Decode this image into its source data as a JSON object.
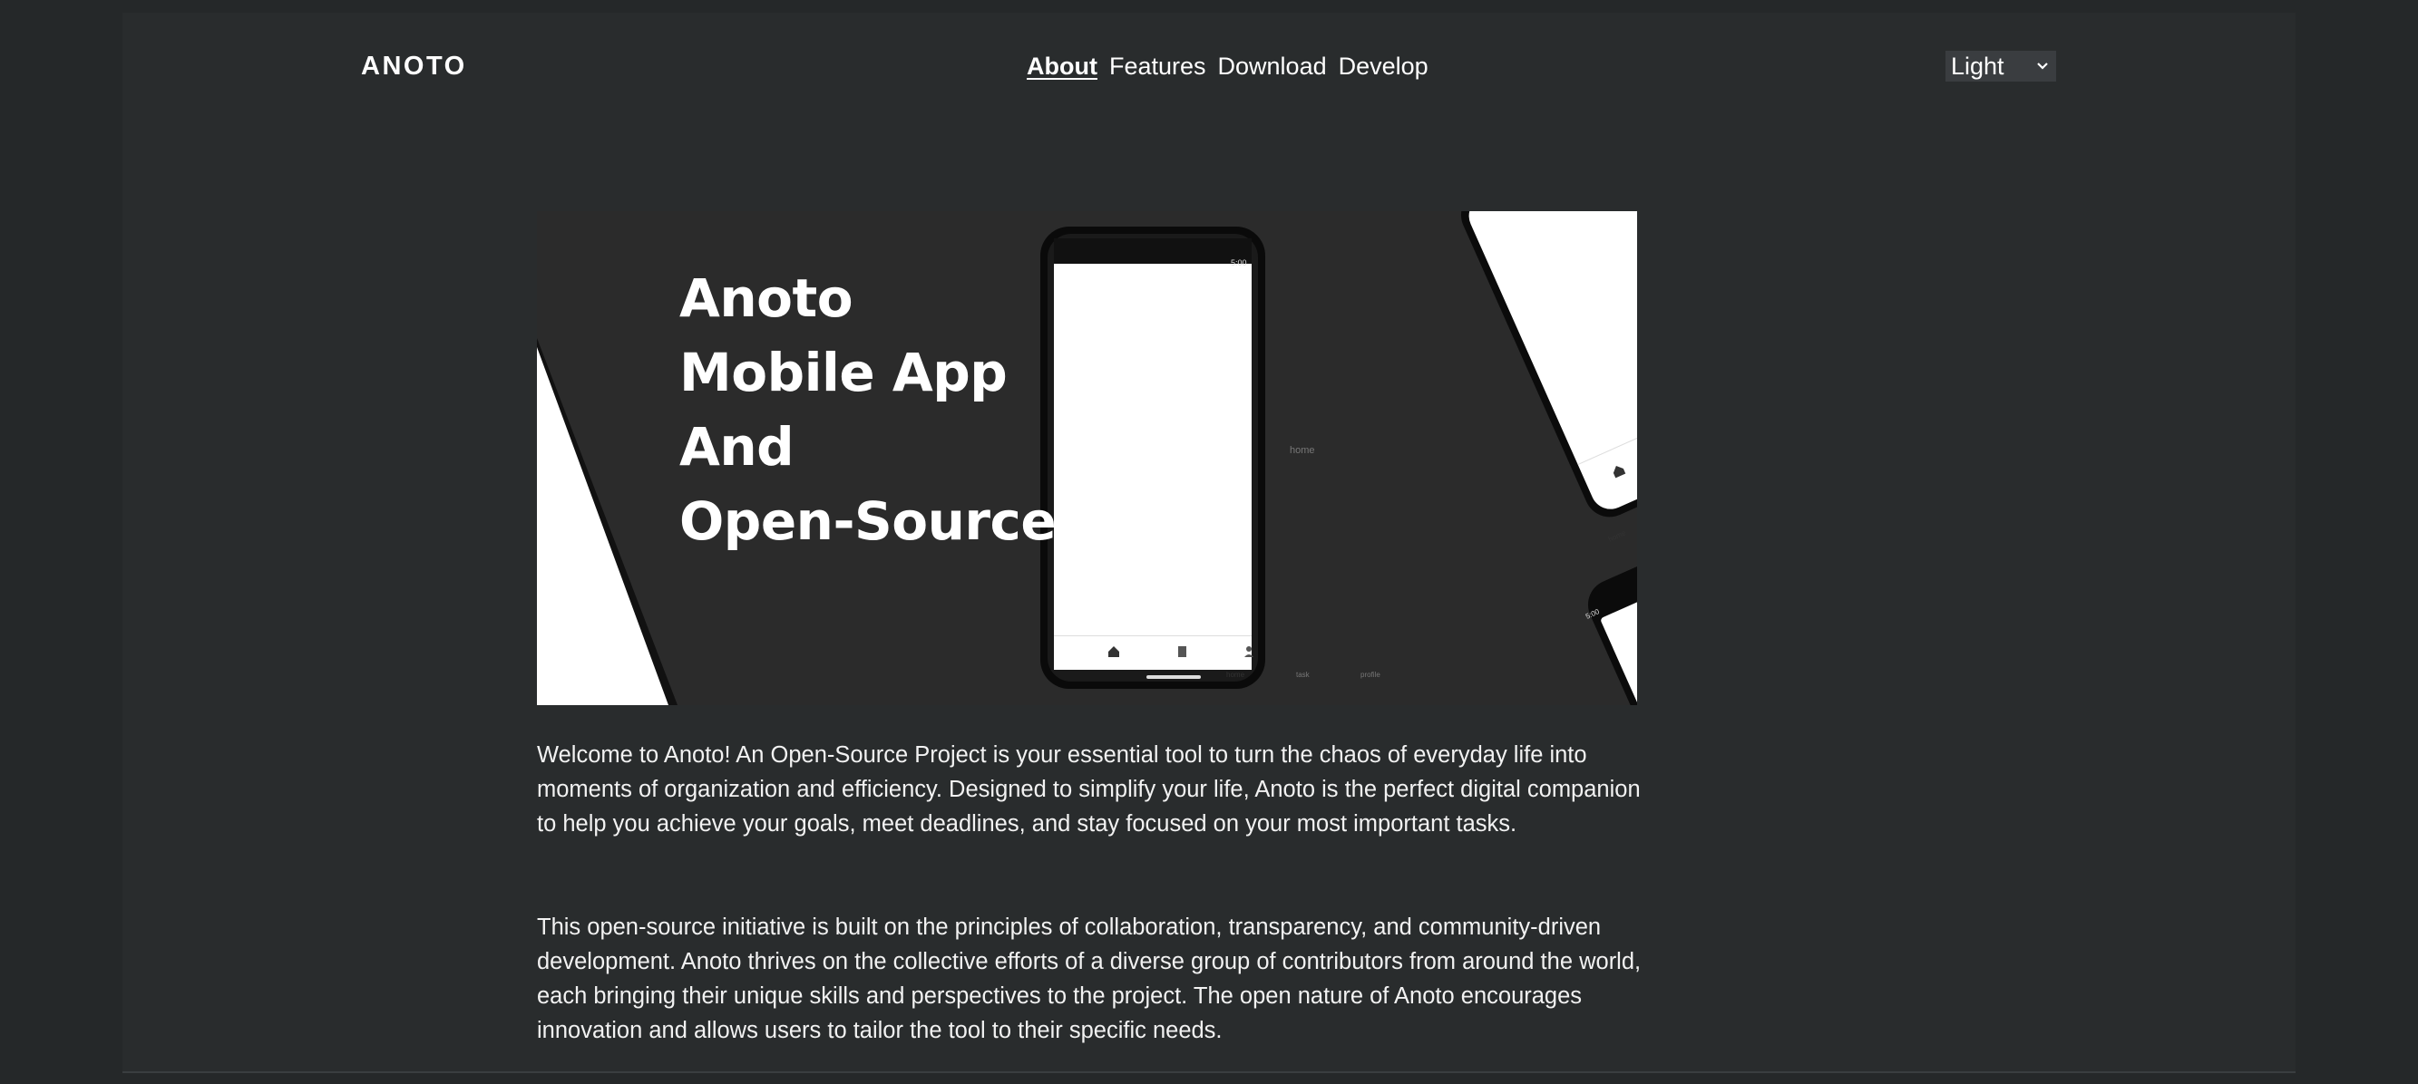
{
  "header": {
    "logo": "ANOTO",
    "nav": [
      {
        "label": "About",
        "active": true
      },
      {
        "label": "Features",
        "active": false
      },
      {
        "label": "Download",
        "active": false
      },
      {
        "label": "Develop",
        "active": false
      }
    ],
    "theme_select": {
      "value": "Light"
    }
  },
  "hero": {
    "title_lines": [
      "Anoto",
      "Mobile App",
      "And",
      "Open-Source"
    ],
    "phone_center": {
      "status_time": "5:00",
      "screen_label": "home",
      "tabs": [
        "home",
        "task",
        "profile"
      ]
    },
    "phone_right_top": {
      "screen_label": "home",
      "tabs": [
        "home",
        "task"
      ]
    },
    "phone_right_bottom": {
      "status_time": "5:00"
    }
  },
  "content": {
    "paragraphs": [
      "Welcome to Anoto! An Open-Source Project is your essential tool to turn the chaos of everyday life into moments of organization and efficiency. Designed to simplify your life, Anoto is the perfect digital companion to help you achieve your goals, meet deadlines, and stay focused on your most important tasks.",
      "This open-source initiative is built on the principles of collaboration, transparency, and community-driven development. Anoto thrives on the collective efforts of a diverse group of contributors from around the world, each bringing their unique skills and perspectives to the project. The open nature of Anoto encourages innovation and allows users to tailor the tool to their specific needs."
    ]
  },
  "colors": {
    "background": "#252829",
    "page": "#292c2d",
    "hero_bg": "#2b2b2b",
    "text": "#ffffff"
  }
}
